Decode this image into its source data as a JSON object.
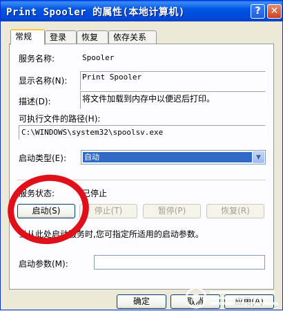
{
  "window": {
    "title": "Print Spooler 的属性(本地计算机)",
    "help_label": "?",
    "close_label": "✕"
  },
  "tabs": [
    {
      "label": "常规",
      "active": true
    },
    {
      "label": "登录",
      "active": false
    },
    {
      "label": "恢复",
      "active": false
    },
    {
      "label": "依存关系",
      "active": false
    }
  ],
  "general": {
    "service_name_label": "服务名称:",
    "service_name_value": "Spooler",
    "display_name_label": "显示名称(N):",
    "display_name_value": "Print Spooler",
    "description_label": "描述(D):",
    "description_value": "将文件加载到内存中以便迟后打印。",
    "exe_path_label": "可执行文件的路径(H):",
    "exe_path_value": "C:\\WINDOWS\\system32\\spoolsv.exe",
    "startup_type_label": "启动类型(E):",
    "startup_type_value": "自动",
    "service_status_label": "服务状态:",
    "service_status_value": "已停止",
    "start_button": "启动(S)",
    "stop_button": "停止(T)",
    "pause_button": "暂停(P)",
    "resume_button": "恢复(R)",
    "hint_text": "当从此处启动服务时,您可指定所适用的启动参数。",
    "start_params_label": "启动参数(M):",
    "start_params_value": ""
  },
  "footer": {
    "ok_button": "确定",
    "cancel_button": "取消",
    "apply_button": "应用(A)"
  },
  "colors": {
    "annotation_circle": "#e0101b",
    "selection": "#316ac5",
    "titlebar": "#0055e5"
  }
}
